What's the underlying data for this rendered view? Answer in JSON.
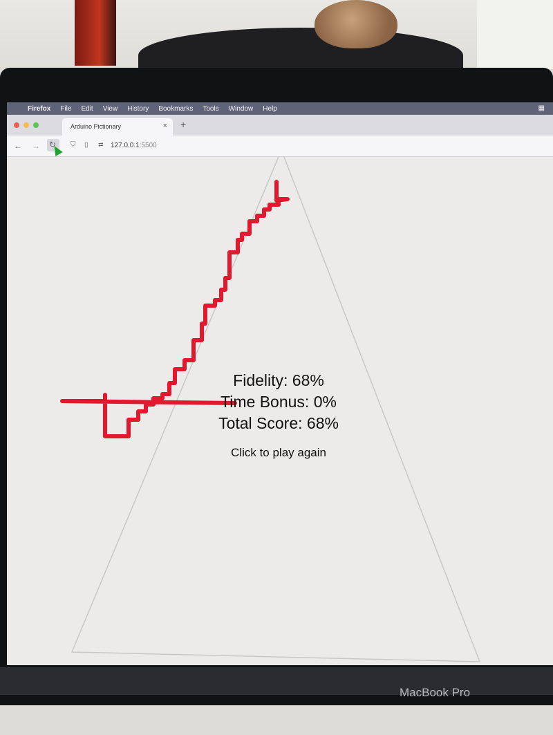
{
  "menubar": {
    "items": [
      "Firefox",
      "File",
      "Edit",
      "View",
      "History",
      "Bookmarks",
      "Tools",
      "Window",
      "Help"
    ]
  },
  "browser": {
    "tab_title": "Arduino Pictionary",
    "tab_close": "×",
    "new_tab": "+",
    "url_host": "127.0.0.1",
    "url_port": ":5500"
  },
  "game": {
    "fidelity_text": "Fidelity: 68%",
    "time_bonus_text": "Time Bonus: 0%",
    "total_score_text": "Total Score: 68%",
    "play_again_text": "Click to play again",
    "target_color": "#c8c8c8",
    "stroke_color": "#e0192e"
  },
  "device": {
    "brand": "MacBook Pro"
  },
  "colors": {
    "menubar": "#5e6377",
    "traffic_close": "#ec5f57",
    "traffic_min": "#f5bd4f",
    "traffic_max": "#5fc452",
    "cursor": "#1fa32a"
  }
}
